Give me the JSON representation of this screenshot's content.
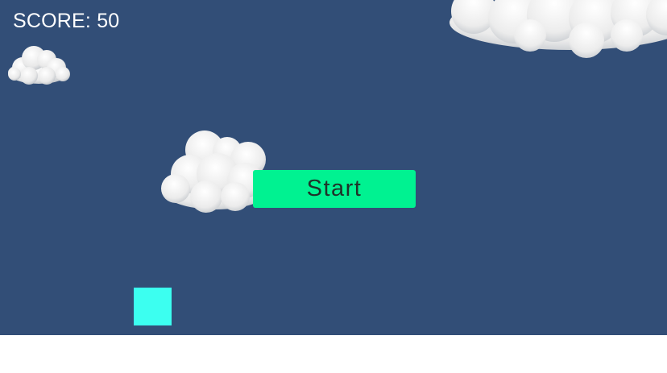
{
  "hud": {
    "score_text": "SCORE: 50"
  },
  "menu": {
    "start_label": "Start"
  },
  "colors": {
    "sky": "#324e77",
    "start_button": "#00f291",
    "start_text": "#1f3229",
    "player": "#3cfff0",
    "cloud": "#f4f4f4",
    "score_text": "#ffffff"
  },
  "sprites": {
    "cloud_icon": "cloud-icon",
    "player_icon": "square-block"
  }
}
